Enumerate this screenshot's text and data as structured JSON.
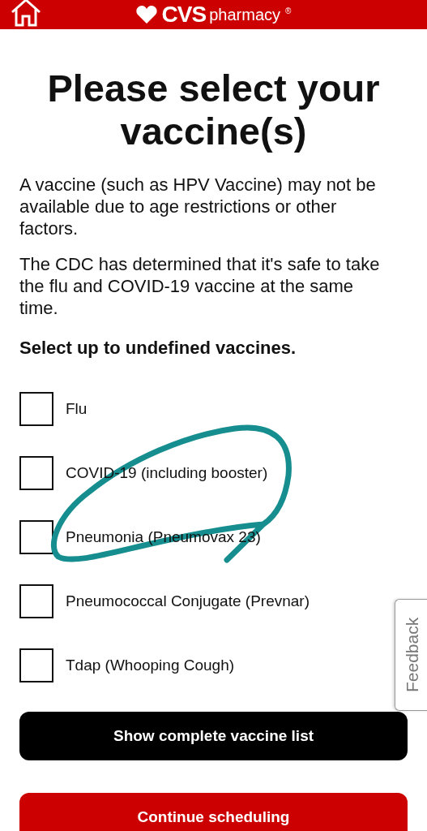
{
  "header": {
    "brand": "CVS",
    "sub": "pharmacy",
    "reg": "®"
  },
  "title": "Please select your vaccine(s)",
  "paragraphs": [
    "A vaccine (such as HPV Vaccine) may not be available due to age restrictions or other factors.",
    "The CDC has determined that it's safe to take the flu and COVID-19 vaccine at the same time."
  ],
  "prompt": "Select up to undefined vaccines.",
  "options": [
    {
      "label": "Flu",
      "checked": false
    },
    {
      "label": "COVID-19 (including booster)",
      "checked": false
    },
    {
      "label": "Pneumonia (Pneumovax 23)",
      "checked": false
    },
    {
      "label": "Pneumococcal Conjugate (Prevnar)",
      "checked": false
    },
    {
      "label": "Tdap (Whooping Cough)",
      "checked": false
    }
  ],
  "buttons": [
    {
      "label": "Show complete vaccine list",
      "kind": "secondary"
    },
    {
      "label": "Continue scheduling",
      "kind": "primary"
    }
  ],
  "feedback": "Feedback"
}
